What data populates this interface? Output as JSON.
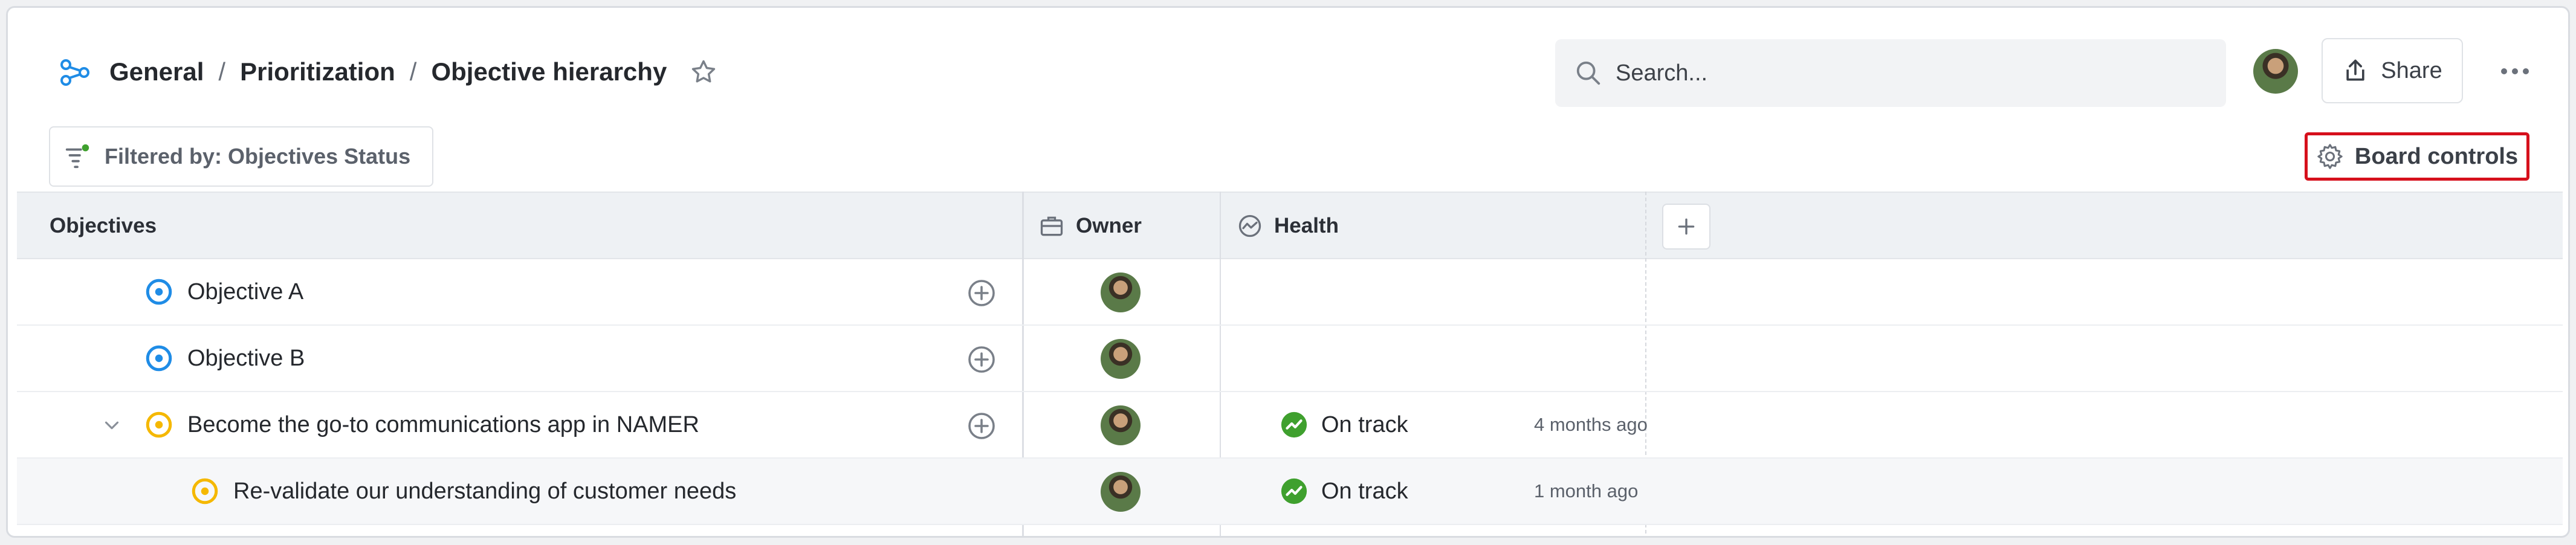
{
  "breadcrumb": {
    "items": [
      "General",
      "Prioritization",
      "Objective hierarchy"
    ],
    "separator": "/"
  },
  "search": {
    "placeholder": "Search..."
  },
  "header": {
    "share_label": "Share"
  },
  "filter": {
    "label": "Filtered by: Objectives Status"
  },
  "board_controls": {
    "label": "Board controls"
  },
  "table": {
    "columns": {
      "objectives": "Objectives",
      "owner": "Owner",
      "health": "Health"
    },
    "rows": [
      {
        "title": "Objective A",
        "icon": "objective-icon-blue",
        "health": "",
        "updated": ""
      },
      {
        "title": "Objective B",
        "icon": "objective-icon-blue",
        "health": "",
        "updated": ""
      },
      {
        "title": "Become the go-to communications app in NAMER",
        "icon": "objective-icon-yellow",
        "health": "On track",
        "updated": "4 months ago"
      },
      {
        "title": "Re-validate our understanding of customer needs",
        "icon": "objective-icon-yellow",
        "health": "On track",
        "updated": "1 month ago"
      }
    ]
  },
  "colors": {
    "accent_blue": "#1f8ce6",
    "objective_yellow": "#f5b800",
    "on_track_green": "#3fa02e",
    "highlight_red": "#d6101c"
  }
}
